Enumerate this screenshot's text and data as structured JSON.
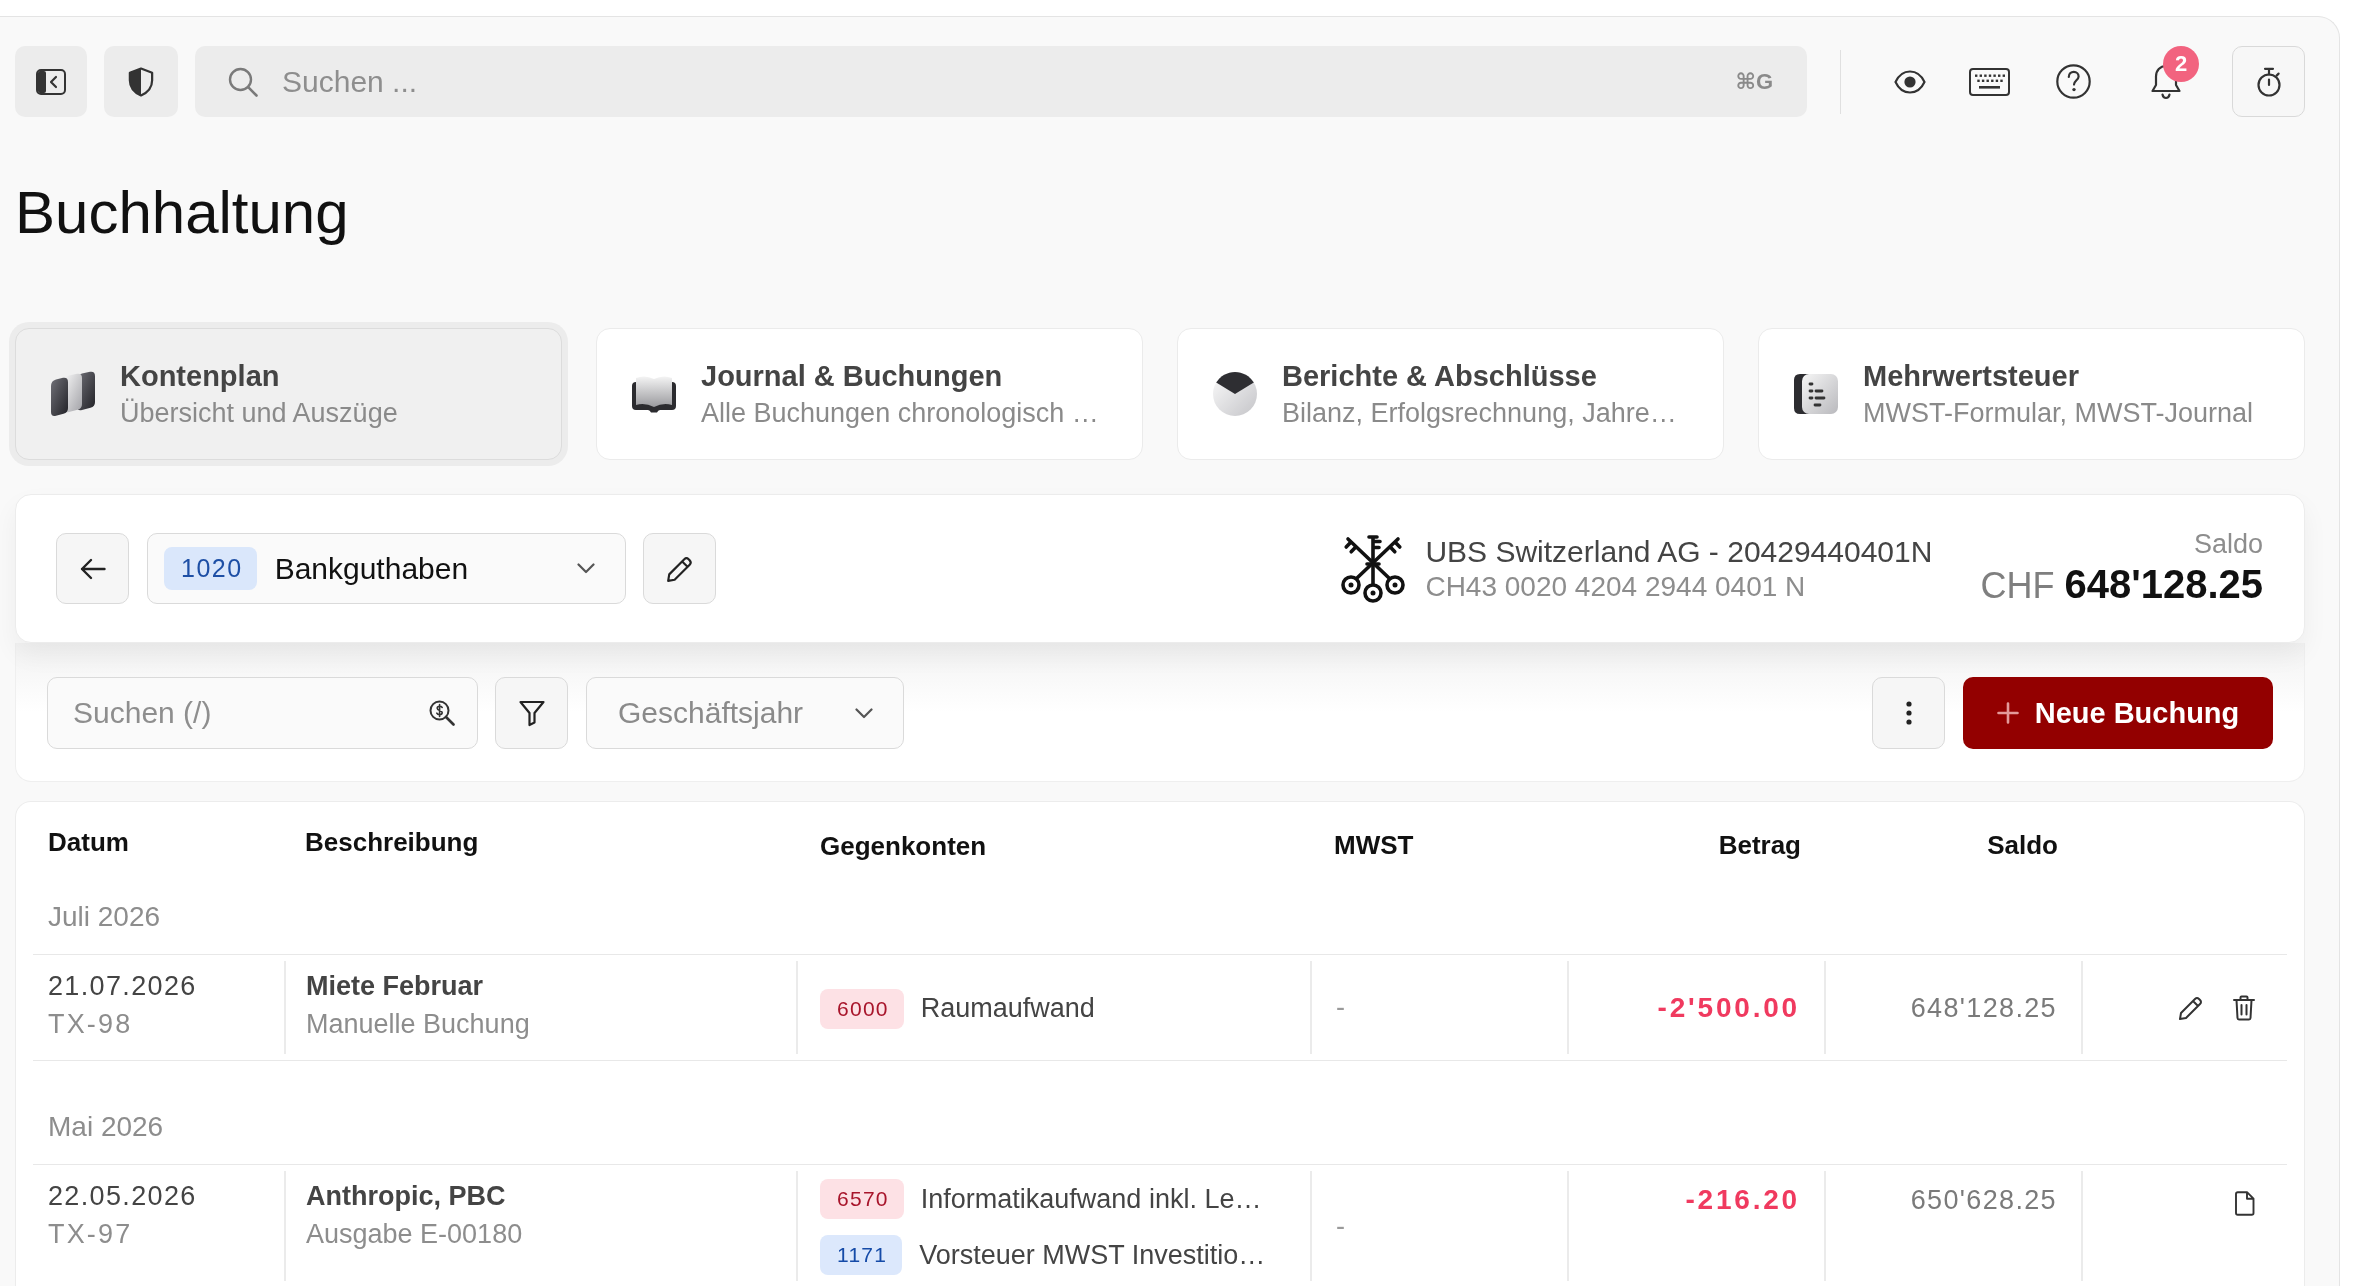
{
  "top_bar": {
    "search": {
      "placeholder": "Suchen ...",
      "shortcut": "⌘G"
    },
    "notifications": {
      "count": "2"
    }
  },
  "page_title": "Buchhaltung",
  "tabs": [
    {
      "title": "Kontenplan",
      "subtitle": "Übersicht und Auszüge",
      "selected": true
    },
    {
      "title": "Journal & Buchungen",
      "subtitle": "Alle Buchungen chronologisch …",
      "selected": false
    },
    {
      "title": "Berichte & Abschlüsse",
      "subtitle": "Bilanz, Erfolgsrechnung, Jahre…",
      "selected": false
    },
    {
      "title": "Mehrwertsteuer",
      "subtitle": "MWST-Formular, MWST-Journal",
      "selected": false
    }
  ],
  "account": {
    "number": "1020",
    "name": "Bankguthaben",
    "bank": {
      "name": "UBS Switzerland AG - 20429440401N",
      "iban": "CH43 0020 4204 2944 0401 N"
    },
    "balance": {
      "label": "Saldo",
      "currency": "CHF",
      "amount": "648'128.25"
    }
  },
  "toolbar": {
    "search": {
      "placeholder": "Suchen (/)"
    },
    "fiscal_year": {
      "placeholder": "Geschäftsjahr"
    },
    "new_button": "Neue Buchung"
  },
  "table": {
    "columns": [
      "Datum",
      "Beschreibung",
      "Gegenkonten",
      "MWST",
      "Betrag",
      "Saldo"
    ],
    "groups": [
      {
        "label": "Juli 2026",
        "rows": [
          {
            "date": "21.07.2026",
            "reference": "TX-98",
            "title": "Miete Februar",
            "subtitle": "Manuelle Buchung",
            "accounts": [
              {
                "number": "6000",
                "name": "Raumaufwand",
                "color": "#fde1e5"
              }
            ],
            "vat": "-",
            "amount": "-2'500.00",
            "negative": true,
            "balance": "648'128.25",
            "actions": [
              {
                "kind": "edit"
              },
              {
                "kind": "delete"
              }
            ]
          }
        ]
      },
      {
        "label": "Mai 2026",
        "rows": [
          {
            "date": "22.05.2026",
            "reference": "TX-97",
            "title": "Anthropic, PBC",
            "subtitle": "Ausgabe E-00180",
            "accounts": [
              {
                "number": "6570",
                "name": "Informatikaufwand inkl. Le…",
                "color": "#fde1e5"
              },
              {
                "number": "1171",
                "name": "Vorsteuer MWST Investitio…",
                "color": "#dce8fc"
              }
            ],
            "vat": "-",
            "amount": "-216.20",
            "negative": true,
            "balance": "650'628.25",
            "actions": [
              {
                "kind": "attachment"
              }
            ]
          }
        ]
      }
    ]
  }
}
